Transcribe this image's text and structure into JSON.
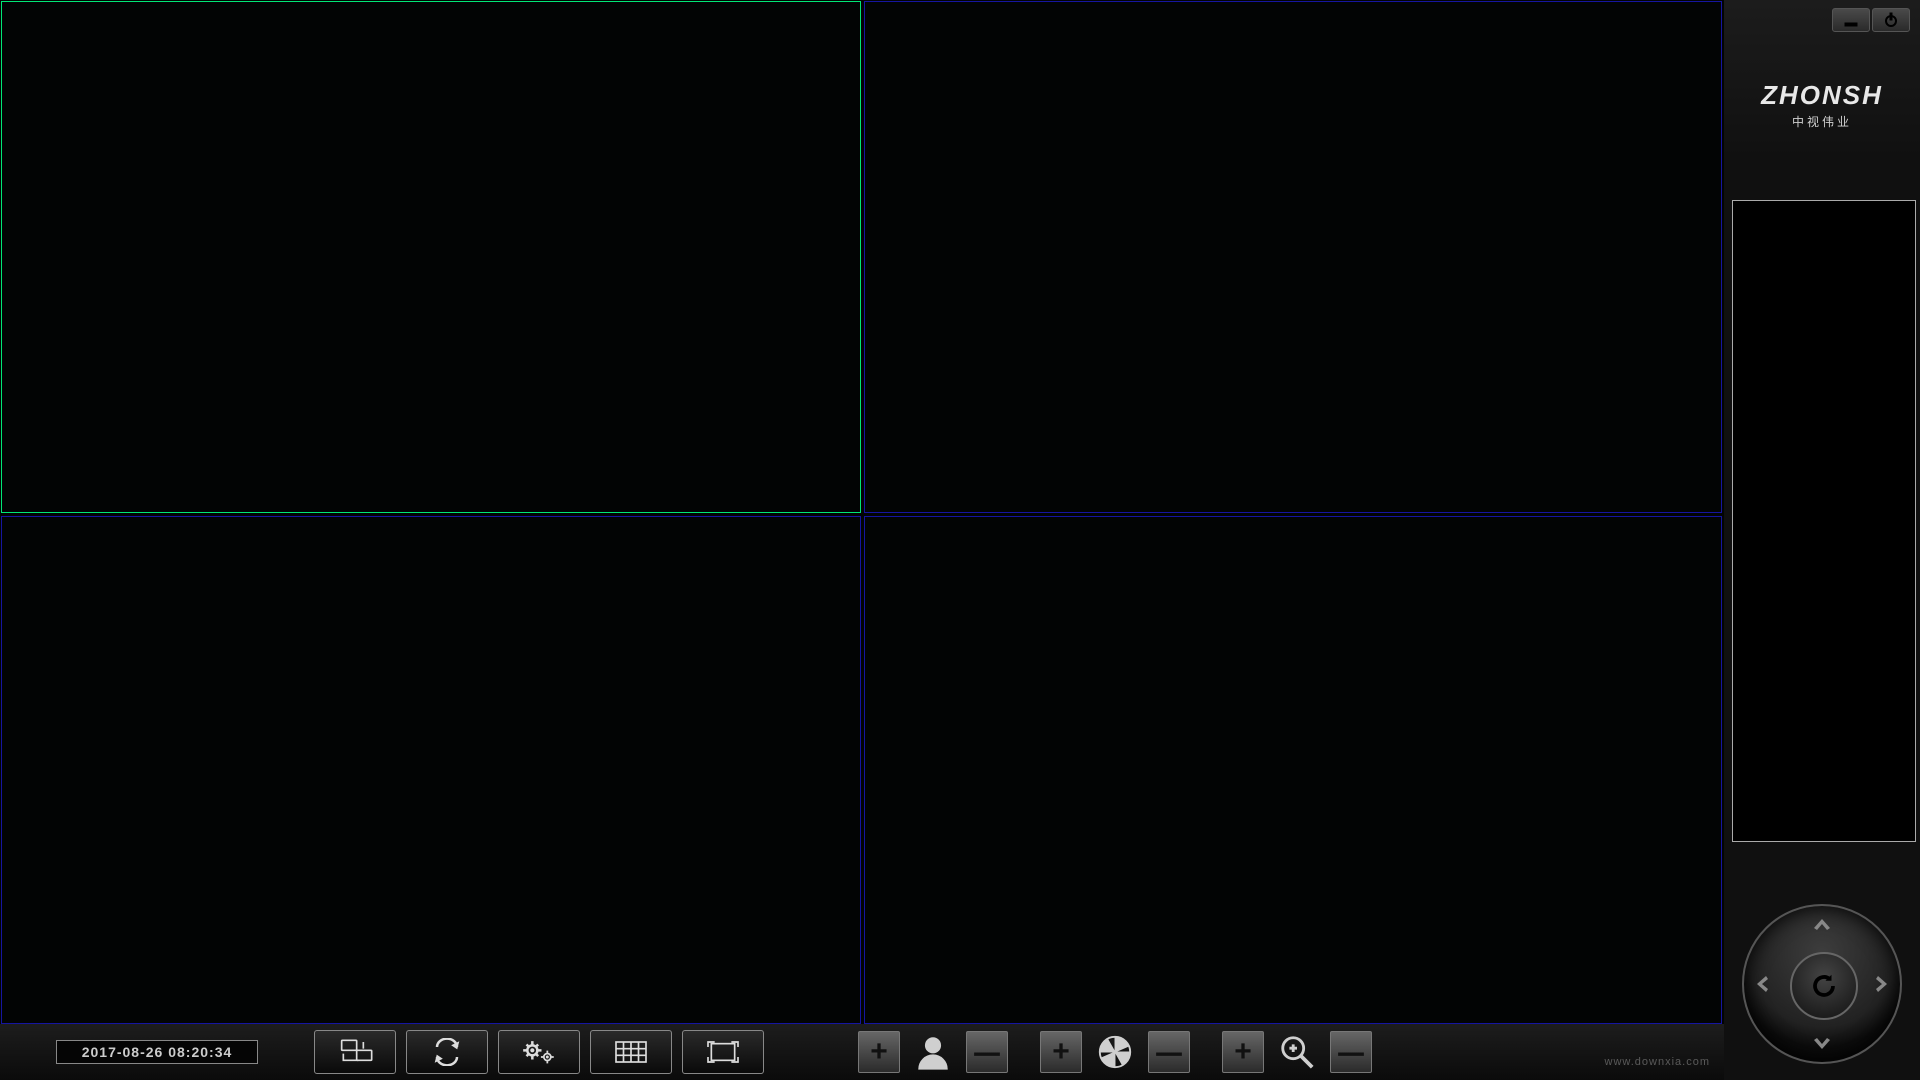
{
  "brand": {
    "main": "ZHONSH",
    "sub": "中视伟业"
  },
  "datetime": "2017-08-26 08:20:34",
  "watermark": "www.downxia.com",
  "icons": {
    "plus": "+",
    "minus": "－"
  },
  "colors": {
    "active_border": "#00e676",
    "inactive_border": "#1515a0"
  }
}
